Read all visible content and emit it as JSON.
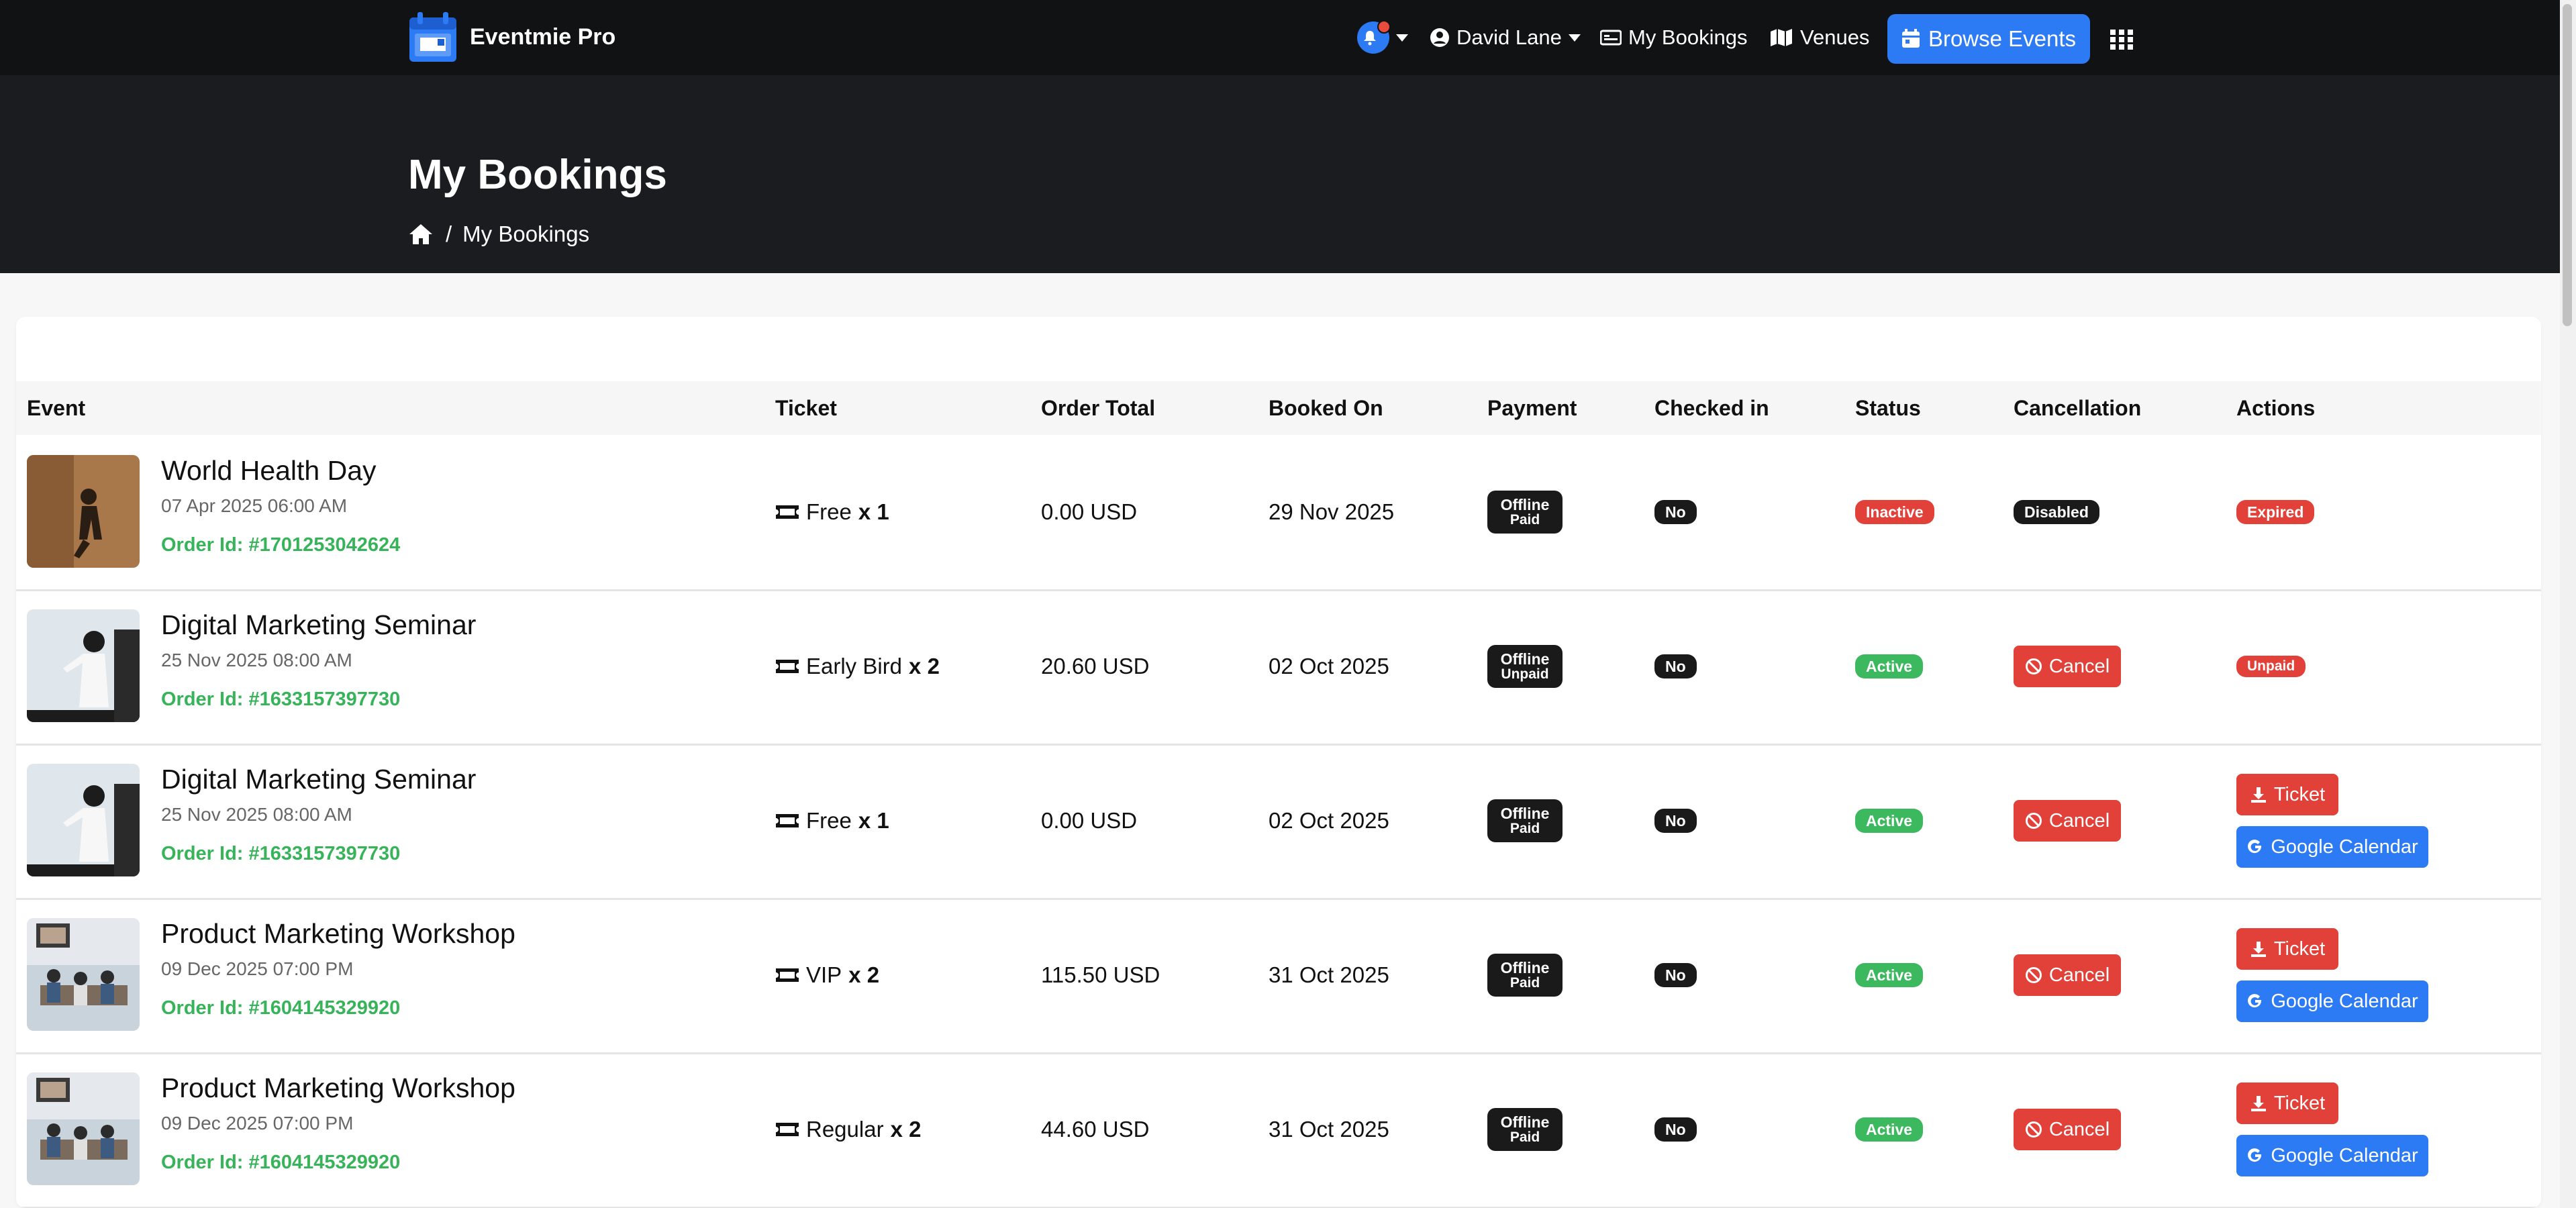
{
  "app": {
    "name": "Eventmie Pro"
  },
  "nav": {
    "user": "David Lane",
    "my_bookings": "My Bookings",
    "venues": "Venues",
    "browse_events": "Browse Events"
  },
  "hero": {
    "title": "My Bookings",
    "breadcrumb_current": "My Bookings",
    "breadcrumb_sep": "/"
  },
  "table": {
    "headers": {
      "event": "Event",
      "ticket": "Ticket",
      "order_total": "Order Total",
      "booked_on": "Booked On",
      "payment": "Payment",
      "checked_in": "Checked in",
      "status": "Status",
      "cancellation": "Cancellation",
      "actions": "Actions"
    },
    "order_label": "Order Id:",
    "ticket_btn": "Ticket",
    "gcal_btn": "Google Calendar",
    "cancel_btn": "Cancel",
    "rows": [
      {
        "title": "World Health Day",
        "date": "07 Apr 2025 06:00 AM",
        "order_id": "#1701253042624",
        "ticket": "Free",
        "qty": "x 1",
        "total": "0.00 USD",
        "booked_on": "29 Nov 2025",
        "pay_method": "Offline",
        "pay_state": "Paid",
        "checked_in": "No",
        "status": "Inactive",
        "cancellation": "Disabled",
        "action": "Expired"
      },
      {
        "title": "Digital Marketing Seminar",
        "date": "25 Nov 2025 08:00 AM",
        "order_id": "#1633157397730",
        "ticket": "Early Bird",
        "qty": "x 2",
        "total": "20.60 USD",
        "booked_on": "02 Oct 2025",
        "pay_method": "Offline",
        "pay_state": "Unpaid",
        "checked_in": "No",
        "status": "Active",
        "cancellation": "Cancel",
        "action": "Unpaid"
      },
      {
        "title": "Digital Marketing Seminar",
        "date": "25 Nov 2025 08:00 AM",
        "order_id": "#1633157397730",
        "ticket": "Free",
        "qty": "x 1",
        "total": "0.00 USD",
        "booked_on": "02 Oct 2025",
        "pay_method": "Offline",
        "pay_state": "Paid",
        "checked_in": "No",
        "status": "Active",
        "cancellation": "Cancel",
        "action": "buttons"
      },
      {
        "title": "Product Marketing Workshop",
        "date": "09 Dec 2025 07:00 PM",
        "order_id": "#1604145329920",
        "ticket": "VIP",
        "qty": "x 2",
        "total": "115.50 USD",
        "booked_on": "31 Oct 2025",
        "pay_method": "Offline",
        "pay_state": "Paid",
        "checked_in": "No",
        "status": "Active",
        "cancellation": "Cancel",
        "action": "buttons"
      },
      {
        "title": "Product Marketing Workshop",
        "date": "09 Dec 2025 07:00 PM",
        "order_id": "#1604145329920",
        "ticket": "Regular",
        "qty": "x 2",
        "total": "44.60 USD",
        "booked_on": "31 Oct 2025",
        "pay_method": "Offline",
        "pay_state": "Paid",
        "checked_in": "No",
        "status": "Active",
        "cancellation": "Cancel",
        "action": "buttons"
      }
    ]
  },
  "colors": {
    "accent": "#2d7bf4",
    "danger": "#e2413a",
    "success": "#3cb85e",
    "nav_bg": "#111213"
  }
}
